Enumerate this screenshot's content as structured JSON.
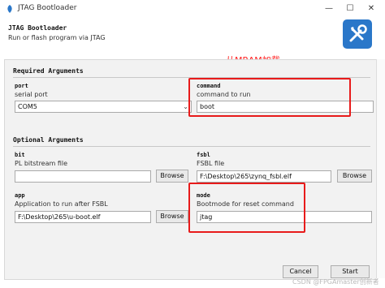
{
  "window": {
    "title": "JTAG Bootloader",
    "minimize_glyph": "—",
    "maximize_glyph": "☐",
    "close_glyph": "✕"
  },
  "header": {
    "title": "JTAG Bootloader",
    "subtitle": "Run or flash program via JTAG",
    "icon": "tools-icon"
  },
  "annotation": "从MRAM加载",
  "required": {
    "label": "Required Arguments",
    "port": {
      "name": "port",
      "help": "serial port",
      "value": "COM5"
    },
    "command": {
      "name": "command",
      "help": "command to run",
      "value": "boot"
    }
  },
  "optional": {
    "label": "Optional Arguments",
    "bit": {
      "name": "bit",
      "help": "PL bitstream file",
      "value": "",
      "button": "Browse"
    },
    "fsbl": {
      "name": "fsbl",
      "help": "FSBL file",
      "value": "F:\\Desktop\\265\\zynq_fsbl.elf",
      "button": "Browse"
    },
    "app": {
      "name": "app",
      "help": "Application to run after FSBL",
      "value": "F:\\Desktop\\265\\u-boot.elf",
      "button": "Browse"
    },
    "mode": {
      "name": "mode",
      "help": "Bootmode for reset command",
      "value": "jtag"
    }
  },
  "footer": {
    "cancel": "Cancel",
    "start": "Start"
  },
  "watermark": "CSDN @FPGAmaster创新者",
  "colors": {
    "accent": "#2a77c9",
    "highlight": "#e81b1b"
  }
}
